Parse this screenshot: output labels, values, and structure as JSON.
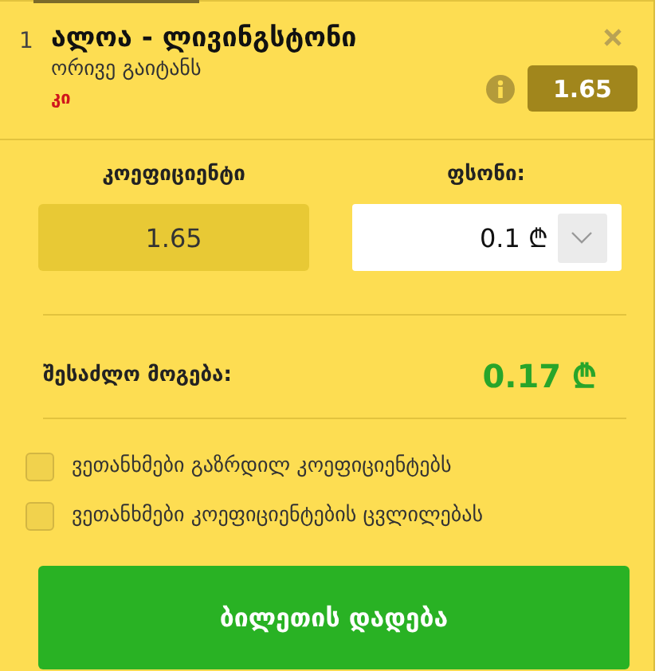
{
  "bet": {
    "number": "1",
    "match": "ალოა - ლივინგსტონი",
    "market": "ორივე გაიტანს",
    "pick": "კი",
    "odds": "1.65"
  },
  "coefficient": {
    "label": "კოეფიციენტი",
    "value": "1.65"
  },
  "stake": {
    "label": "ფსონი:",
    "value": "0.1 ₾"
  },
  "possible_win": {
    "label": "შესაძლო მოგება:",
    "value": "0.17 ₾"
  },
  "options": [
    {
      "label": "ვეთანხმები გაზრდილ კოეფიციენტებს",
      "checked": false
    },
    {
      "label": "ვეთანხმები კოეფიციენტების ცვლილებას",
      "checked": false
    }
  ],
  "submit": "ბილეთის დადება"
}
